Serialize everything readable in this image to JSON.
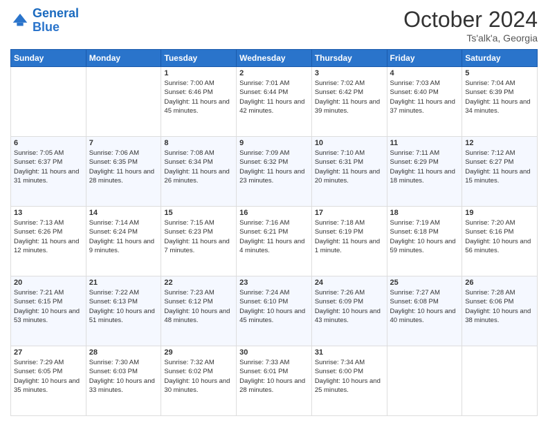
{
  "logo": {
    "line1": "General",
    "line2": "Blue"
  },
  "header": {
    "month": "October 2024",
    "location": "Ts'alk'a, Georgia"
  },
  "weekdays": [
    "Sunday",
    "Monday",
    "Tuesday",
    "Wednesday",
    "Thursday",
    "Friday",
    "Saturday"
  ],
  "weeks": [
    [
      {
        "day": "",
        "info": ""
      },
      {
        "day": "",
        "info": ""
      },
      {
        "day": "1",
        "info": "Sunrise: 7:00 AM\nSunset: 6:46 PM\nDaylight: 11 hours and 45 minutes."
      },
      {
        "day": "2",
        "info": "Sunrise: 7:01 AM\nSunset: 6:44 PM\nDaylight: 11 hours and 42 minutes."
      },
      {
        "day": "3",
        "info": "Sunrise: 7:02 AM\nSunset: 6:42 PM\nDaylight: 11 hours and 39 minutes."
      },
      {
        "day": "4",
        "info": "Sunrise: 7:03 AM\nSunset: 6:40 PM\nDaylight: 11 hours and 37 minutes."
      },
      {
        "day": "5",
        "info": "Sunrise: 7:04 AM\nSunset: 6:39 PM\nDaylight: 11 hours and 34 minutes."
      }
    ],
    [
      {
        "day": "6",
        "info": "Sunrise: 7:05 AM\nSunset: 6:37 PM\nDaylight: 11 hours and 31 minutes."
      },
      {
        "day": "7",
        "info": "Sunrise: 7:06 AM\nSunset: 6:35 PM\nDaylight: 11 hours and 28 minutes."
      },
      {
        "day": "8",
        "info": "Sunrise: 7:08 AM\nSunset: 6:34 PM\nDaylight: 11 hours and 26 minutes."
      },
      {
        "day": "9",
        "info": "Sunrise: 7:09 AM\nSunset: 6:32 PM\nDaylight: 11 hours and 23 minutes."
      },
      {
        "day": "10",
        "info": "Sunrise: 7:10 AM\nSunset: 6:31 PM\nDaylight: 11 hours and 20 minutes."
      },
      {
        "day": "11",
        "info": "Sunrise: 7:11 AM\nSunset: 6:29 PM\nDaylight: 11 hours and 18 minutes."
      },
      {
        "day": "12",
        "info": "Sunrise: 7:12 AM\nSunset: 6:27 PM\nDaylight: 11 hours and 15 minutes."
      }
    ],
    [
      {
        "day": "13",
        "info": "Sunrise: 7:13 AM\nSunset: 6:26 PM\nDaylight: 11 hours and 12 minutes."
      },
      {
        "day": "14",
        "info": "Sunrise: 7:14 AM\nSunset: 6:24 PM\nDaylight: 11 hours and 9 minutes."
      },
      {
        "day": "15",
        "info": "Sunrise: 7:15 AM\nSunset: 6:23 PM\nDaylight: 11 hours and 7 minutes."
      },
      {
        "day": "16",
        "info": "Sunrise: 7:16 AM\nSunset: 6:21 PM\nDaylight: 11 hours and 4 minutes."
      },
      {
        "day": "17",
        "info": "Sunrise: 7:18 AM\nSunset: 6:19 PM\nDaylight: 11 hours and 1 minute."
      },
      {
        "day": "18",
        "info": "Sunrise: 7:19 AM\nSunset: 6:18 PM\nDaylight: 10 hours and 59 minutes."
      },
      {
        "day": "19",
        "info": "Sunrise: 7:20 AM\nSunset: 6:16 PM\nDaylight: 10 hours and 56 minutes."
      }
    ],
    [
      {
        "day": "20",
        "info": "Sunrise: 7:21 AM\nSunset: 6:15 PM\nDaylight: 10 hours and 53 minutes."
      },
      {
        "day": "21",
        "info": "Sunrise: 7:22 AM\nSunset: 6:13 PM\nDaylight: 10 hours and 51 minutes."
      },
      {
        "day": "22",
        "info": "Sunrise: 7:23 AM\nSunset: 6:12 PM\nDaylight: 10 hours and 48 minutes."
      },
      {
        "day": "23",
        "info": "Sunrise: 7:24 AM\nSunset: 6:10 PM\nDaylight: 10 hours and 45 minutes."
      },
      {
        "day": "24",
        "info": "Sunrise: 7:26 AM\nSunset: 6:09 PM\nDaylight: 10 hours and 43 minutes."
      },
      {
        "day": "25",
        "info": "Sunrise: 7:27 AM\nSunset: 6:08 PM\nDaylight: 10 hours and 40 minutes."
      },
      {
        "day": "26",
        "info": "Sunrise: 7:28 AM\nSunset: 6:06 PM\nDaylight: 10 hours and 38 minutes."
      }
    ],
    [
      {
        "day": "27",
        "info": "Sunrise: 7:29 AM\nSunset: 6:05 PM\nDaylight: 10 hours and 35 minutes."
      },
      {
        "day": "28",
        "info": "Sunrise: 7:30 AM\nSunset: 6:03 PM\nDaylight: 10 hours and 33 minutes."
      },
      {
        "day": "29",
        "info": "Sunrise: 7:32 AM\nSunset: 6:02 PM\nDaylight: 10 hours and 30 minutes."
      },
      {
        "day": "30",
        "info": "Sunrise: 7:33 AM\nSunset: 6:01 PM\nDaylight: 10 hours and 28 minutes."
      },
      {
        "day": "31",
        "info": "Sunrise: 7:34 AM\nSunset: 6:00 PM\nDaylight: 10 hours and 25 minutes."
      },
      {
        "day": "",
        "info": ""
      },
      {
        "day": "",
        "info": ""
      }
    ]
  ]
}
